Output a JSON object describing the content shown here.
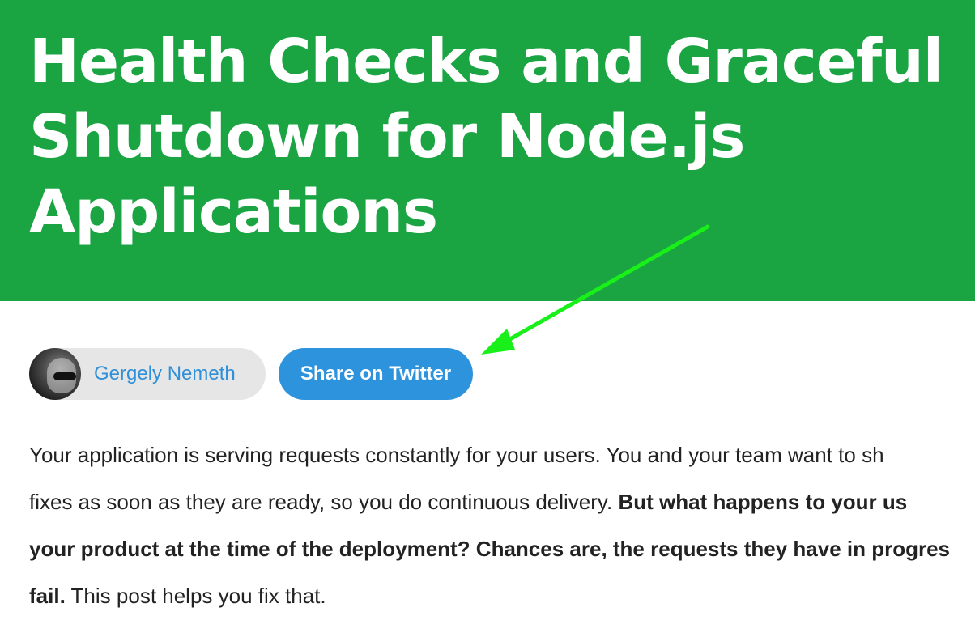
{
  "colors": {
    "brand": "#1aa442",
    "twitter": "#2e93dd",
    "link": "#2f8fd8",
    "arrow": "#19f019"
  },
  "article": {
    "title_lines": [
      "Health Checks and Graceful",
      "Shutdown for Node.js",
      "Applications"
    ],
    "author": {
      "name": "Gergely Nemeth",
      "avatar_icon": "author-avatar"
    },
    "share_button_label": "Share on Twitter",
    "intro": {
      "line1": "Your application is serving requests constantly for your users. You and your team want to sh",
      "line2_plain": "fixes as soon as they are ready, so you do continuous delivery. ",
      "line2_bold": "But what happens to your us",
      "line3_bold": "your product at the time of the deployment? Chances are, the requests they have in progres",
      "line4_bold": "fail.",
      "line4_plain": " This post helps you fix that."
    }
  }
}
